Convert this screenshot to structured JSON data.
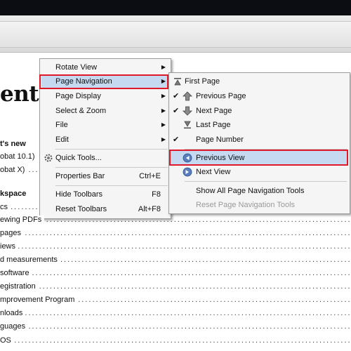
{
  "document": {
    "heading": "ents",
    "sections": [
      "t's new",
      "kspace"
    ],
    "toc": [
      "obat 10.1)",
      "obat X)",
      "cs",
      "ewing PDFs",
      "pages",
      "iews",
      "d measurements",
      "software",
      "egistration",
      "mprovement Program",
      "nloads",
      "guages",
      "OS"
    ],
    "toc_dots": "............................................................................................................................"
  },
  "view_menu": {
    "items": [
      {
        "label": "Rotate View",
        "has_submenu": true
      },
      {
        "label": "Page Navigation",
        "has_submenu": true,
        "highlighted": true
      },
      {
        "label": "Page Display",
        "has_submenu": true
      },
      {
        "label": "Select & Zoom",
        "has_submenu": true
      },
      {
        "label": "File",
        "has_submenu": true
      },
      {
        "label": "Edit",
        "has_submenu": true
      },
      {
        "label": "Quick Tools...",
        "icon": "gear-icon"
      },
      {
        "label": "Properties Bar",
        "shortcut": "Ctrl+E"
      },
      {
        "label": "Hide Toolbars",
        "shortcut": "F8"
      },
      {
        "label": "Reset Toolbars",
        "shortcut": "Alt+F8"
      }
    ]
  },
  "page_nav_submenu": {
    "items": [
      {
        "label": "First Page",
        "icon": "first-page-icon"
      },
      {
        "label": "Previous Page",
        "icon": "previous-page-icon",
        "checked": true
      },
      {
        "label": "Next Page",
        "icon": "next-page-icon",
        "checked": true
      },
      {
        "label": "Last Page",
        "icon": "last-page-icon"
      },
      {
        "label": "Page Number",
        "checked": true
      },
      {
        "label": "Previous View",
        "icon": "previous-view-icon",
        "highlighted": true
      },
      {
        "label": "Next View",
        "icon": "next-view-icon"
      },
      {
        "label": "Show All Page Navigation Tools"
      },
      {
        "label": "Reset Page Navigation Tools",
        "disabled": true
      }
    ]
  },
  "colors": {
    "highlight": "#c5d9f1",
    "annotation_red": "#e0192a",
    "titlebar": "#0b0d12"
  }
}
